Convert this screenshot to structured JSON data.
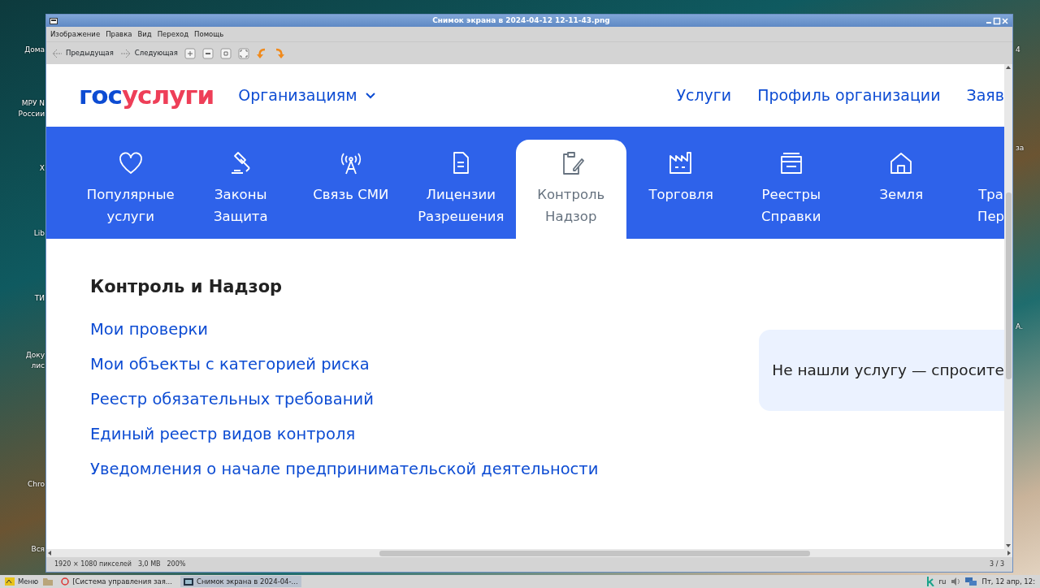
{
  "desktop": {
    "left_labels": [
      {
        "lines": [
          "Дома"
        ]
      },
      {
        "lines": [
          "МРУ N",
          "России"
        ]
      },
      {
        "lines": [
          "Х"
        ]
      },
      {
        "lines": [
          "Lib"
        ]
      },
      {
        "lines": [
          "ТИ"
        ]
      },
      {
        "lines": [
          "Доку",
          "лис"
        ]
      },
      {
        "lines": [
          "Chro"
        ]
      },
      {
        "lines": [
          "Вся"
        ]
      }
    ],
    "right_labels": [
      {
        "lines": [
          "4"
        ]
      },
      {
        "lines": [
          "за"
        ]
      },
      {
        "lines": [
          "А."
        ]
      }
    ]
  },
  "window": {
    "title": "Снимок экрана в 2024-04-12 12-11-43.png",
    "menu": [
      "Изображение",
      "Правка",
      "Вид",
      "Переход",
      "Помощь"
    ],
    "toolbar": [
      {
        "kind": "prev",
        "label": "Предыдущая"
      },
      {
        "kind": "next",
        "label": "Следующая"
      },
      {
        "kind": "zoom-in"
      },
      {
        "kind": "zoom-out"
      },
      {
        "kind": "zoom-fit"
      },
      {
        "kind": "fullscreen"
      },
      {
        "kind": "rotate-left"
      },
      {
        "kind": "rotate-right"
      }
    ],
    "status": [
      "1920 × 1080 пикселей",
      "3,0 MB",
      "200%"
    ],
    "page_counter": "3 / 3"
  },
  "site": {
    "logo": [
      {
        "text": "гос",
        "color": "#0d4cd3"
      },
      {
        "text": "услуги",
        "color": "#ee3f58"
      }
    ],
    "org_menu": "Организациям",
    "nav": [
      "Услуги",
      "Профиль организации",
      "Заяв"
    ],
    "tabs": [
      {
        "lines": [
          "Популярные",
          "услуги"
        ],
        "kind": "heart",
        "selected": false
      },
      {
        "lines": [
          "Законы",
          "Защита"
        ],
        "kind": "gavel",
        "selected": false
      },
      {
        "lines": [
          "Связь СМИ"
        ],
        "kind": "antenna",
        "selected": false
      },
      {
        "lines": [
          "Лицензии",
          "Разрешения"
        ],
        "kind": "document",
        "selected": false
      },
      {
        "lines": [
          "Контроль",
          "Надзор"
        ],
        "kind": "clipboard",
        "selected": true
      },
      {
        "lines": [
          "Торговля"
        ],
        "kind": "factory",
        "selected": false
      },
      {
        "lines": [
          "Реестры",
          "Справки"
        ],
        "kind": "wallet",
        "selected": false
      },
      {
        "lines": [
          "Земля"
        ],
        "kind": "house",
        "selected": false
      },
      {
        "lines": [
          "Тра",
          "Пер"
        ],
        "selected": false
      }
    ],
    "section_title": "Контроль и Надзор",
    "links": [
      "Мои проверки",
      "Мои объекты с категорией риска",
      "Реестр обязательных требований",
      "Единый реестр видов контроля",
      "Уведомления о начале предпринимательской деятельности"
    ],
    "help_card": "Не нашли услугу — спросите"
  },
  "taskbar": {
    "menu": "Меню",
    "tasks": [
      {
        "label": "[Система управления зая...",
        "kind": "browser",
        "selected": false
      },
      {
        "label": "Снимок экрана в 2024-04-...",
        "kind": "viewer",
        "selected": true
      }
    ],
    "lang": "ru",
    "clock": "Пт, 12 апр, 12:"
  }
}
